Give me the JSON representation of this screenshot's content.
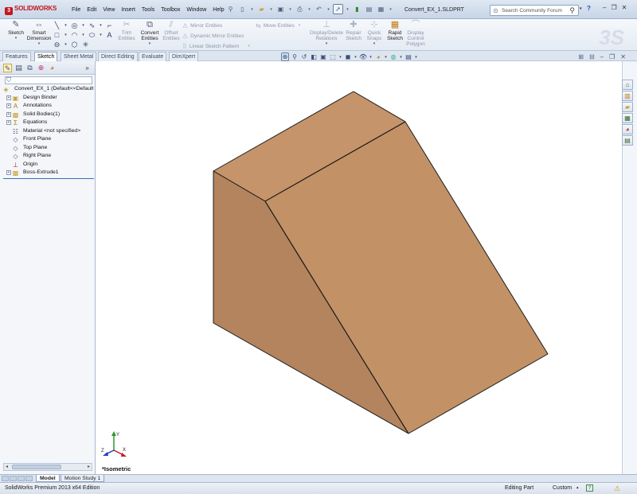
{
  "app": {
    "brand": "SOLIDWORKS",
    "document_title": "Convert_EX_1.SLDPRT"
  },
  "menu": [
    "File",
    "Edit",
    "View",
    "Insert",
    "Tools",
    "Toolbox",
    "Window",
    "Help"
  ],
  "search": {
    "placeholder": "Search Community Forum"
  },
  "command_manager": {
    "sketch": "Sketch",
    "smart_dimension": [
      "Smart",
      "Dimension"
    ],
    "trim": [
      "Trim",
      "Entities"
    ],
    "convert": [
      "Convert",
      "Entities"
    ],
    "offset": [
      "Offset",
      "Entities"
    ],
    "mirror_entities": "Mirror Entities",
    "dynamic_mirror": "Dynamic Mirror Entities",
    "linear_pattern": "Linear Sketch Pattern",
    "move_entities": "Move Entities",
    "display_delete": [
      "Display/Delete",
      "Relations"
    ],
    "repair": [
      "Repair",
      "Sketch"
    ],
    "quick_snaps": [
      "Quick",
      "Snaps"
    ],
    "rapid_sketch": [
      "Rapid",
      "Sketch"
    ],
    "control_polygon": [
      "Display",
      "Control",
      "Polygon"
    ]
  },
  "tabs": [
    "Features",
    "Sketch",
    "Sheet Metal",
    "Direct Editing",
    "Evaluate",
    "DimXpert"
  ],
  "active_tab": "Sketch",
  "feature_tree": {
    "root": "Convert_EX_1  (Default<<Default",
    "items": [
      {
        "label": "Design Binder",
        "icon": "binder-icon",
        "expandable": true
      },
      {
        "label": "Annotations",
        "icon": "annotation-icon",
        "expandable": true
      },
      {
        "label": "Solid Bodies(1)",
        "icon": "solid-bodies-icon",
        "expandable": true
      },
      {
        "label": "Equations",
        "icon": "equations-icon",
        "expandable": true
      },
      {
        "label": "Material <not specified>",
        "icon": "material-icon",
        "expandable": false
      },
      {
        "label": "Front Plane",
        "icon": "plane-icon",
        "expandable": false
      },
      {
        "label": "Top Plane",
        "icon": "plane-icon",
        "expandable": false
      },
      {
        "label": "Right Plane",
        "icon": "plane-icon",
        "expandable": false
      },
      {
        "label": "Origin",
        "icon": "origin-icon",
        "expandable": false
      },
      {
        "label": "Boss-Extrude1",
        "icon": "extrude-icon",
        "expandable": true
      }
    ]
  },
  "viewport": {
    "view_orientation": "*Isometric",
    "model_colors": {
      "top": "#c5946a",
      "front_left": "#b3845e",
      "slope": "#c29166",
      "edge": "#1a1a1a"
    },
    "triad_labels": {
      "x": "X",
      "y": "Y",
      "z": "Z"
    }
  },
  "bottom_tabs": [
    "Model",
    "Motion Study 1"
  ],
  "status": {
    "edition": "SolidWorks Premium 2013 x64 Edition",
    "mode": "Editing Part",
    "units": "Custom"
  }
}
